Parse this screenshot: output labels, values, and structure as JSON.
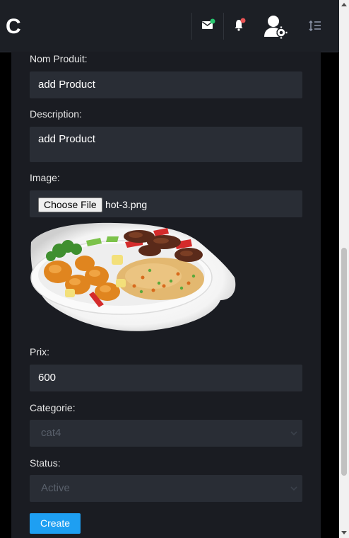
{
  "navbar": {
    "brand": "C",
    "icons": [
      "mail-icon",
      "bell-icon",
      "user-settings-icon",
      "sort-icon"
    ],
    "mail_badge_color": "#28c76f",
    "bell_badge_color": "#ea5455"
  },
  "form": {
    "name_label": "Nom Produit:",
    "name_value": "add Product",
    "description_label": "Description:",
    "description_value": "add Product",
    "image_label": "Image:",
    "file_button": "Choose File",
    "file_name": "hot-3.png",
    "price_label": "Prix:",
    "price_value": "600",
    "category_label": "Categorie:",
    "category_value": "cat4",
    "status_label": "Status:",
    "status_value": "Active",
    "submit_label": "Create"
  },
  "colors": {
    "panel_bg": "#1a1c22",
    "field_bg": "#292d35",
    "accent": "#1e9ff2"
  }
}
